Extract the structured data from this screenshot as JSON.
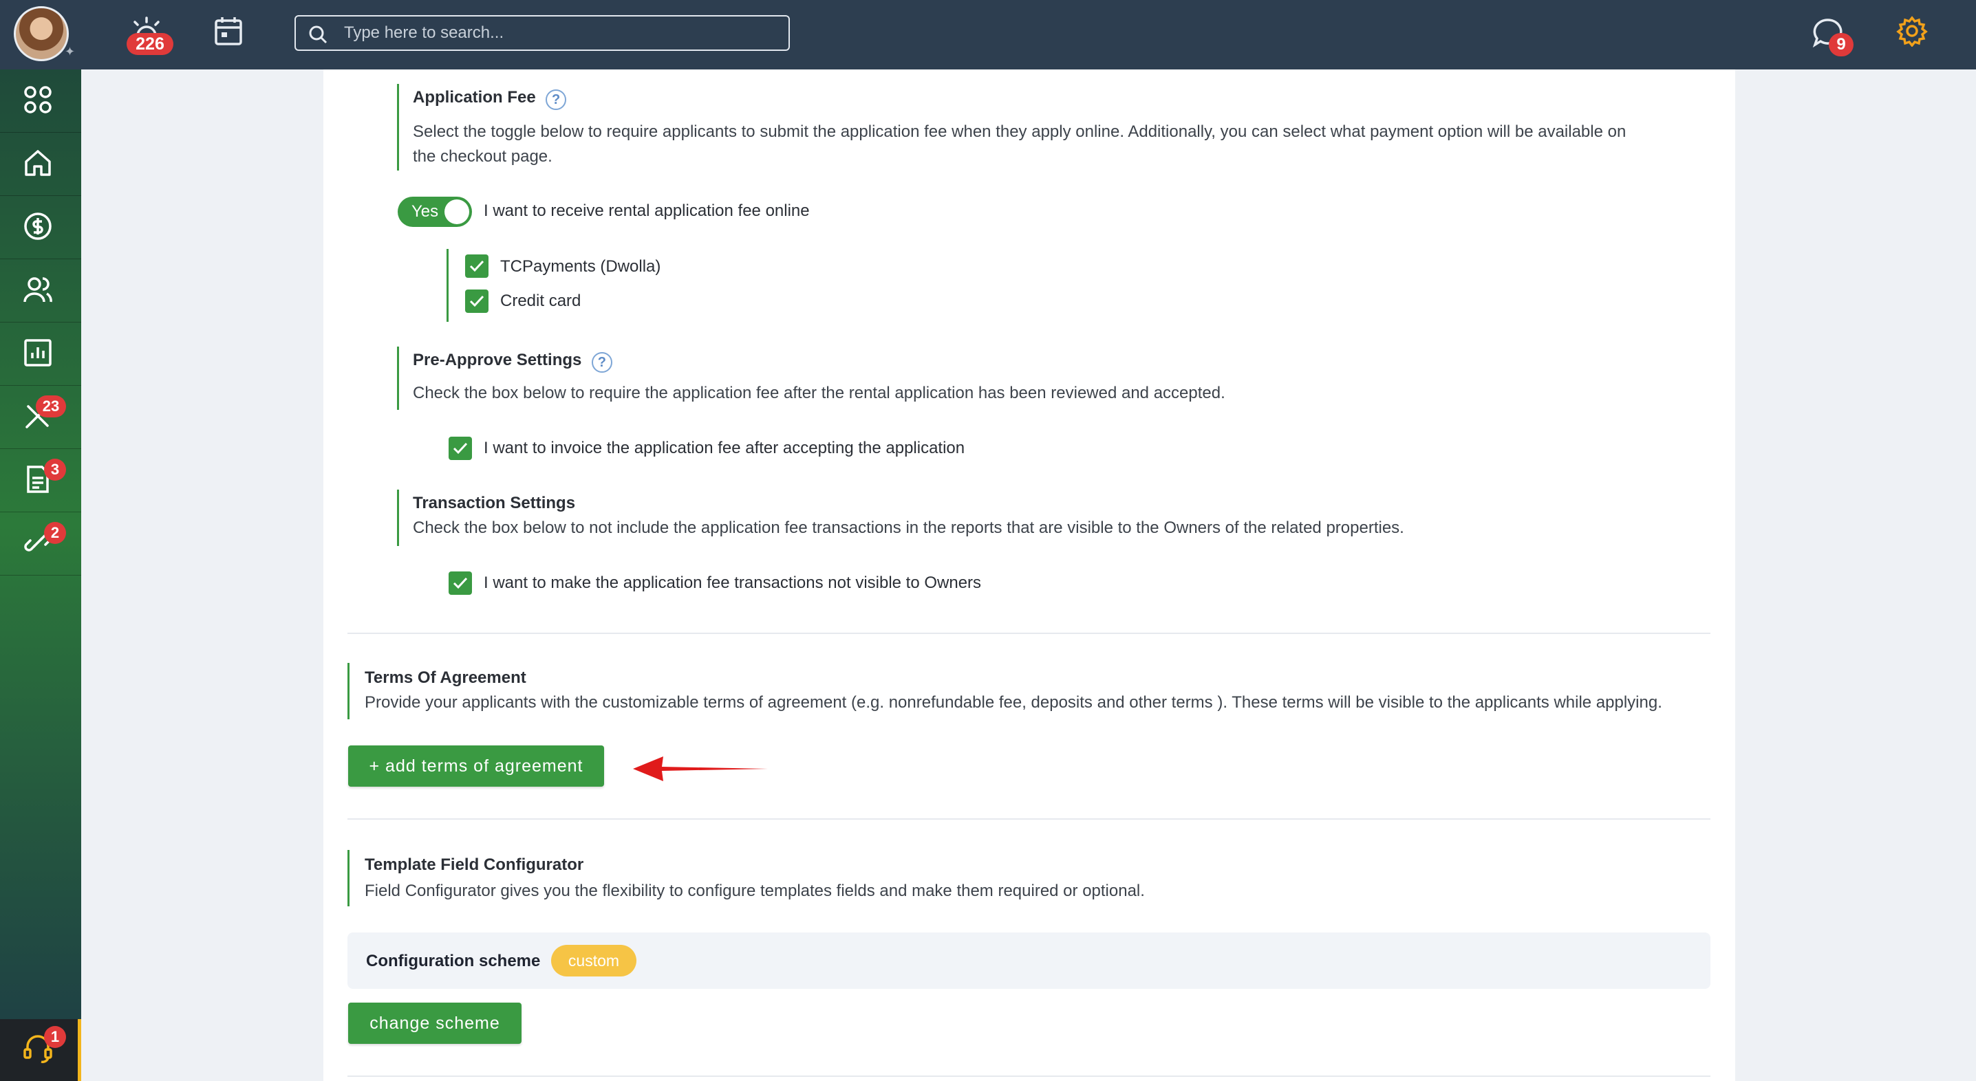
{
  "topbar": {
    "alarm_badge": "226",
    "search_placeholder": "Type here to search...",
    "chat_badge": "9"
  },
  "sidebar": {
    "items": [
      {
        "name": "dashboard",
        "icon": "grid-icon",
        "badge": ""
      },
      {
        "name": "home",
        "icon": "home-icon",
        "badge": ""
      },
      {
        "name": "payments",
        "icon": "dollar-icon",
        "badge": ""
      },
      {
        "name": "people",
        "icon": "users-icon",
        "badge": ""
      },
      {
        "name": "reports",
        "icon": "chart-icon",
        "badge": ""
      },
      {
        "name": "maintenance",
        "icon": "tools-icon",
        "badge": "23"
      },
      {
        "name": "documents",
        "icon": "document-icon",
        "badge": "3"
      },
      {
        "name": "links",
        "icon": "link-icon",
        "badge": "2"
      }
    ],
    "support_badge": "1"
  },
  "application_fee": {
    "title": "Application Fee",
    "description_1": "Select the toggle below to require applicants to submit the application fee when they apply online. Additionally, you can select what payment option will be available on",
    "description_2": "the checkout page.",
    "toggle_label": "Yes",
    "toggle_text": "I want to receive rental application fee online",
    "options": [
      "TCPayments (Dwolla)",
      "Credit card"
    ]
  },
  "pre_approve": {
    "title": "Pre-Approve Settings",
    "description": "Check the box below to require the application fee after the rental application has been reviewed and accepted.",
    "checkbox_text": "I want to invoice the application fee after accepting the application"
  },
  "transaction": {
    "title": "Transaction Settings",
    "description": "Check the box below to not include the application fee transactions in the reports that are visible to the Owners of the related properties.",
    "checkbox_text": "I want to make the application fee transactions not visible to Owners"
  },
  "terms": {
    "title": "Terms Of Agreement",
    "description": "Provide your applicants with the customizable terms of agreement (e.g. nonrefundable fee, deposits and other terms ). These terms will be visible to the applicants while applying.",
    "button": "+ add terms of agreement"
  },
  "template": {
    "title": "Template Field Configurator",
    "description": "Field Configurator gives you the flexibility to configure templates fields and make them required or optional.",
    "scheme_label": "Configuration scheme",
    "scheme_value": "custom",
    "button": "change scheme"
  },
  "colors": {
    "topbar": "#2d3e50",
    "accent_green": "#3a9a42",
    "badge_red": "#e03a3a",
    "pill_yellow": "#f6c445",
    "gear_orange": "#f2a11a",
    "arrow_red": "#e01b1b"
  }
}
